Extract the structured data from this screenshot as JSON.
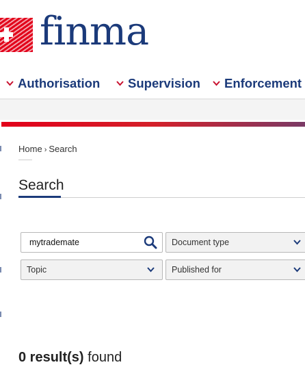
{
  "brand": {
    "name": "finma",
    "accent": "#e2001a",
    "navy": "#1b3a7a"
  },
  "nav": {
    "items": [
      {
        "label": "Authorisation",
        "icon": "chevron-down-icon"
      },
      {
        "label": "Supervision",
        "icon": "chevron-down-icon"
      },
      {
        "label": "Enforcement",
        "icon": "chevron-down-icon"
      }
    ]
  },
  "breadcrumb": {
    "home": "Home",
    "separator": "›",
    "current": "Search"
  },
  "page": {
    "title": "Search"
  },
  "search": {
    "query": "mytrademate",
    "search_icon": "search-icon",
    "document_type": "Document type",
    "topic": "Topic",
    "published_for": "Published for"
  },
  "results": {
    "count": "0 result(s)",
    "suffix": "found"
  }
}
